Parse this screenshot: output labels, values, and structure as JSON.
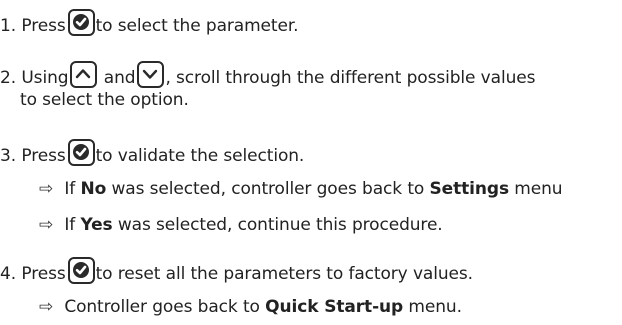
{
  "steps": [
    {
      "number": "1.",
      "before": "Press",
      "after": "to select the parameter."
    },
    {
      "number": "2.",
      "before": "Using",
      "middle": "and",
      "after": ", scroll through the different possible values",
      "continuation": "to select the option."
    },
    {
      "number": "3.",
      "before": "Press",
      "after": "to validate the selection."
    },
    {
      "number": "4.",
      "before": "Press",
      "after": "to reset all the parameters to factory values."
    }
  ],
  "results": {
    "no": {
      "arrow": "⇨",
      "pre": "If",
      "bold": "No",
      "mid": "was selected, controller goes back to",
      "bold2": "Settings",
      "post": "menu"
    },
    "yes": {
      "arrow": "⇨",
      "pre": "If",
      "bold": "Yes",
      "post": "was selected, continue this procedure."
    },
    "final": {
      "arrow": "⇨",
      "pre": "Controller goes back to",
      "bold": "Quick Start-up",
      "post": "menu."
    }
  },
  "icons": {
    "validate": "check-button-icon",
    "up": "up-arrow-button-icon",
    "down": "down-arrow-button-icon"
  }
}
